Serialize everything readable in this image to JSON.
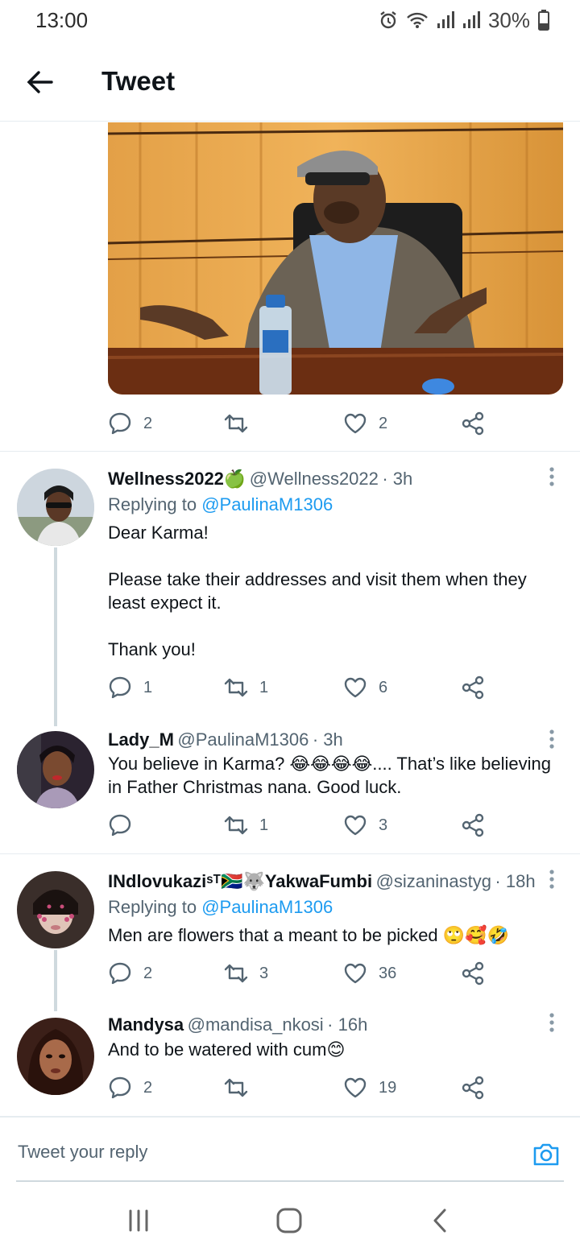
{
  "status_bar": {
    "time": "13:00",
    "battery": "30%",
    "icons": [
      "alarm-icon",
      "wifi-icon",
      "signal-icon",
      "signal-icon",
      "battery-icon"
    ]
  },
  "header": {
    "title": "Tweet",
    "back_icon": "arrow-left-icon"
  },
  "main_tweet": {
    "actions": {
      "replies": "2",
      "retweets": "",
      "likes": "2"
    }
  },
  "replies": [
    {
      "name": "Wellness2022🍏",
      "handle": "@Wellness2022",
      "time": "· 3h",
      "replying_prefix": "Replying to ",
      "replying_to": "@PaulinaM1306",
      "text": "Dear Karma!\n\nPlease take their addresses and visit them when they least expect it.\n\nThank you!",
      "replies": "1",
      "retweets": "1",
      "likes": "6"
    },
    {
      "name": "Lady_M",
      "handle": "@PaulinaM1306",
      "time": "· 3h",
      "text": "You believe in Karma? 😂😂😂😂.... That’s like believing in Father Christmas nana. Good luck.",
      "replies": "",
      "retweets": "1",
      "likes": "3"
    },
    {
      "name": "INdlovukaziˢᵀ🇿🇦🐺YakwaFumbi",
      "handle": "@sizaninastyg",
      "time": "· 18h",
      "replying_prefix": "Replying to ",
      "replying_to": "@PaulinaM1306",
      "text": "Men are flowers that a meant to be picked 🙄🥰🤣",
      "replies": "2",
      "retweets": "3",
      "likes": "36"
    },
    {
      "name": "Mandysa",
      "handle": "@mandisa_nkosi",
      "time": "· 16h",
      "text": "And to be watered with cum😊",
      "replies": "2",
      "retweets": "",
      "likes": "19"
    }
  ],
  "reply_bar": {
    "placeholder": "Tweet your reply",
    "camera_icon": "camera-icon"
  },
  "nav_bar": {
    "icons": [
      "recent-apps-icon",
      "home-icon",
      "back-icon"
    ]
  },
  "colors": {
    "link": "#1d9bf0",
    "secondary": "#536471",
    "divider": "#e6ecf0"
  }
}
